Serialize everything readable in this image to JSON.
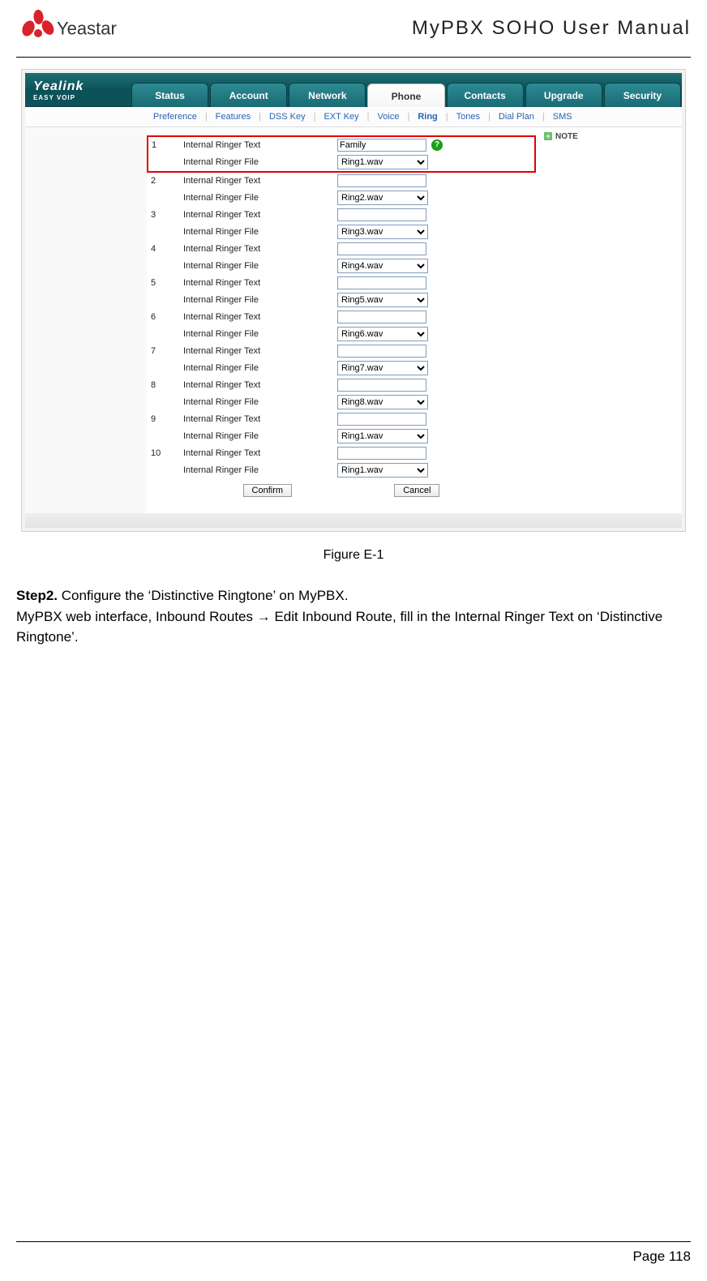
{
  "header": {
    "brand_text": "Yeastar",
    "doc_title": "MyPBX SOHO User Manual"
  },
  "screenshot": {
    "brand_main": "Yealink",
    "brand_sub": "EASY VOIP",
    "tabs": [
      "Status",
      "Account",
      "Network",
      "Phone",
      "Contacts",
      "Upgrade",
      "Security"
    ],
    "active_tab_index": 3,
    "subtabs": [
      "Preference",
      "Features",
      "DSS Key",
      "EXT Key",
      "Voice",
      "Ring",
      "Tones",
      "Dial Plan",
      "SMS"
    ],
    "active_subtab_index": 5,
    "note_label": "NOTE",
    "label_text": "Internal Ringer Text",
    "label_file": "Internal Ringer File",
    "rows": [
      {
        "n": "1",
        "text": "Family",
        "file": "Ring1.wav",
        "highlight": true,
        "help": true
      },
      {
        "n": "2",
        "text": "",
        "file": "Ring2.wav"
      },
      {
        "n": "3",
        "text": "",
        "file": "Ring3.wav"
      },
      {
        "n": "4",
        "text": "",
        "file": "Ring4.wav"
      },
      {
        "n": "5",
        "text": "",
        "file": "Ring5.wav"
      },
      {
        "n": "6",
        "text": "",
        "file": "Ring6.wav"
      },
      {
        "n": "7",
        "text": "",
        "file": "Ring7.wav"
      },
      {
        "n": "8",
        "text": "",
        "file": "Ring8.wav"
      },
      {
        "n": "9",
        "text": "",
        "file": "Ring1.wav"
      },
      {
        "n": "10",
        "text": "",
        "file": "Ring1.wav"
      }
    ],
    "confirm_label": "Confirm",
    "cancel_label": "Cancel"
  },
  "figure_caption": "Figure E-1",
  "body": {
    "step_label": "Step2.",
    "step_rest": " Configure the ‘Distinctive Ringtone’ on MyPBX.",
    "line2": "MyPBX web interface, Inbound Routes → Edit Inbound Route, fill in the Internal Ringer Text on ‘Distinctive Ringtone’."
  },
  "footer": {
    "page_label": "Page 118"
  }
}
